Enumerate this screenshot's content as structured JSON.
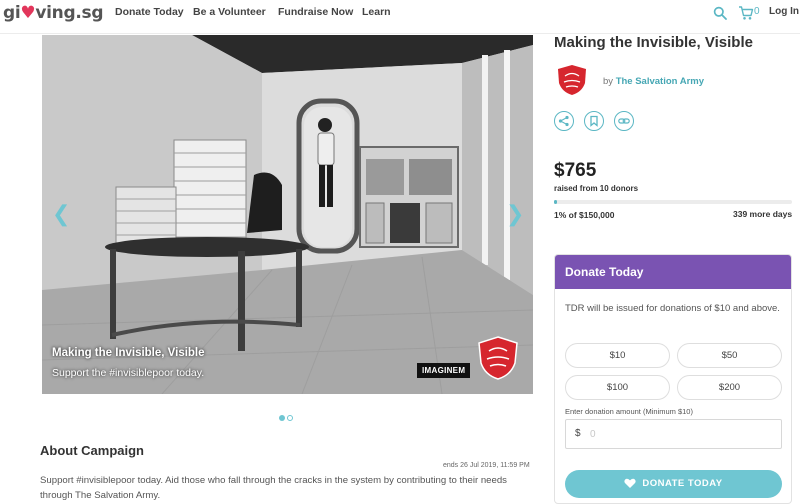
{
  "brand": {
    "logo_left": "gi",
    "logo_mid": "ving.sg"
  },
  "nav": {
    "links": [
      "Donate Today",
      "Be a Volunteer",
      "Fundraise Now",
      "Learn"
    ],
    "cart_count": "0",
    "login_label": "Log In"
  },
  "hero": {
    "caption_title": "Making the Invisible, Visible",
    "caption_sub": "Support the #invisiblepoor today.",
    "watermark": "IMAGINEM",
    "slides_total": 2,
    "slide_active": 1
  },
  "campaign": {
    "title": "Making the Invisible, Visible",
    "by_prefix": "by",
    "org_name": "The Salvation Army",
    "amount": "$765",
    "raised_text": "raised from 10 donors",
    "progress_fraction": 0.01,
    "progress_text": "1% of $150,000",
    "days_text": "339 more days"
  },
  "about": {
    "title": "About Campaign",
    "ends": "ends 26 Jul 2019, 11:59 PM",
    "body": "Support #invisiblepoor today. Aid those who fall through the cracks in the system by contributing to their needs through The Salvation Army."
  },
  "donate": {
    "header": "Donate Today",
    "tdr_note": "TDR will be issued for donations of $10 and above.",
    "amounts": [
      "$10",
      "$50",
      "$100",
      "$200"
    ],
    "input_label": "Enter donation amount (Minimum $10)",
    "currency": "$",
    "input_placeholder": "0",
    "cta": "DONATE TODAY"
  },
  "colors": {
    "accent": "#6fc6d2",
    "purple": "#7a53b2",
    "brand_red": "#e2365b",
    "org_red": "#d6262e"
  },
  "icons": [
    "search-icon",
    "cart-icon",
    "share-icon",
    "bookmark-icon",
    "link-icon",
    "chevron-left-icon",
    "chevron-right-icon",
    "heart-icon"
  ]
}
